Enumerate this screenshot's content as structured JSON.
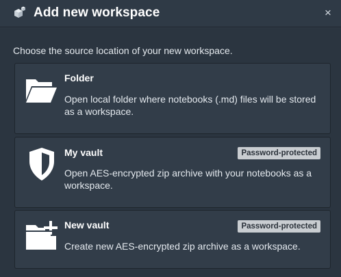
{
  "dialog": {
    "title": "Add new workspace",
    "close_label": "×",
    "intro": "Choose the source location of your new workspace."
  },
  "options": [
    {
      "icon": "folder-open-icon",
      "title": "Folder",
      "description": "Open local folder where notebooks (.md) files will be stored as a workspace.",
      "badge": ""
    },
    {
      "icon": "shield-icon",
      "title": "My vault",
      "description": "Open AES-encrypted zip archive with your notebooks as a workspace.",
      "badge": "Password-protected"
    },
    {
      "icon": "folder-plus-icon",
      "title": "New vault",
      "description": "Create new AES-encrypted zip archive as a workspace.",
      "badge": "Password-protected"
    }
  ],
  "colors": {
    "background": "#2f3a46",
    "card": "#323d49",
    "badge_bg": "#c9cdd1",
    "text": "#ffffff"
  }
}
